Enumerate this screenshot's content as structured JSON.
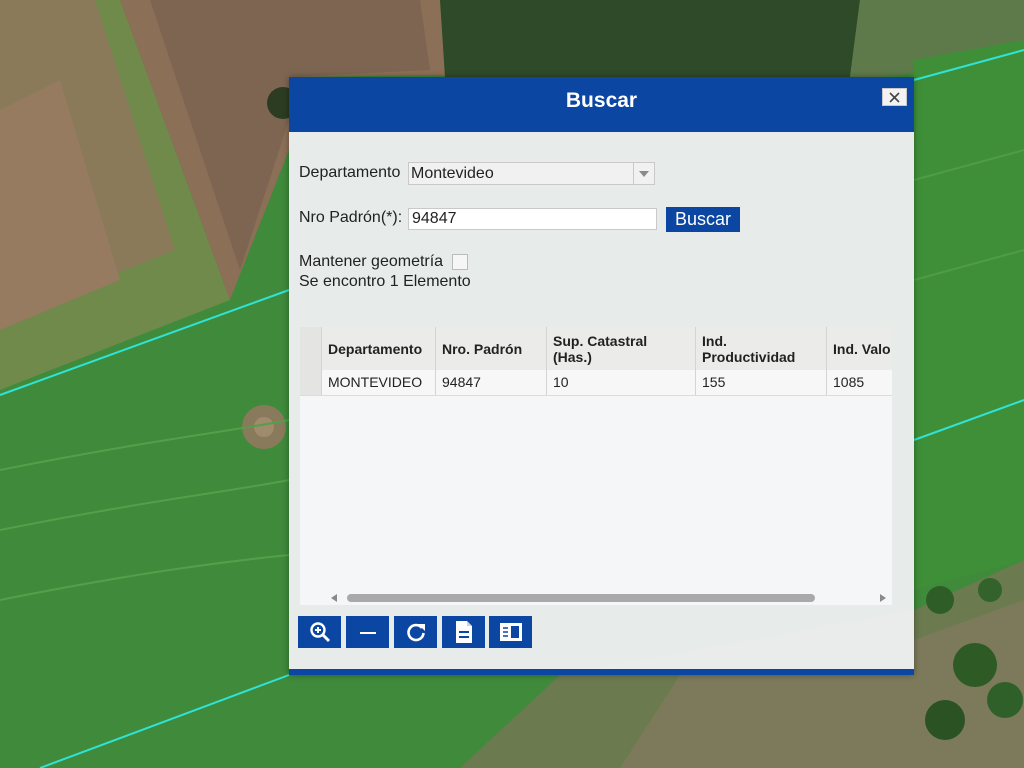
{
  "dialog": {
    "title": "Buscar",
    "close_label": "×"
  },
  "form": {
    "departamento_label": "Departamento",
    "departamento_value": "Montevideo",
    "padron_label": "Nro Padrón(*):",
    "padron_value": "94847",
    "search_button": "Buscar",
    "mantener_label": "Mantener geometría",
    "mantener_checked": false,
    "result_text": "Se encontro 1 Elemento"
  },
  "grid": {
    "columns": [
      "Departamento",
      "Nro. Padrón",
      "Sup. Catastral (Has.)",
      "Ind. Productividad",
      "Ind. Valo"
    ],
    "rows": [
      [
        "MONTEVIDEO",
        "94847",
        "10",
        "155",
        "1085"
      ]
    ]
  },
  "toolbar": {
    "buttons": [
      "zoom-in-icon",
      "minus-icon",
      "refresh-icon",
      "document-icon",
      "panel-icon"
    ]
  },
  "colors": {
    "accent": "#0b46a3",
    "map_line": "#2fe3d6"
  }
}
